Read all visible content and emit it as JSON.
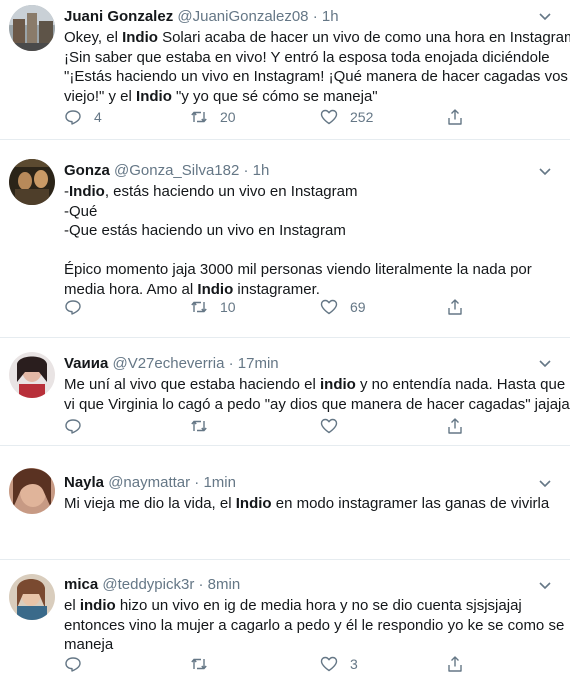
{
  "tweets": [
    {
      "name": "Juani Gonzalez",
      "handle": "@JuaniGonzalez08",
      "sep": "·",
      "time": "1h",
      "lines": [
        [
          {
            "t": "Okey, el "
          },
          {
            "t": "Indio",
            "b": true
          },
          {
            "t": " Solari acaba de hacer un vivo de como una hora en Instagram"
          }
        ],
        [
          {
            "t": "¡Sin saber que estaba en vivo! Y entró la esposa toda enojada diciéndole"
          }
        ],
        [
          {
            "t": "\"¡Estás haciendo un vivo en Instagram! ¡Qué manera de hacer cagadas vos"
          }
        ],
        [
          {
            "t": "viejo!\" y el "
          },
          {
            "t": "Indio",
            "b": true
          },
          {
            "t": " \"y yo que sé cómo se maneja\""
          }
        ]
      ],
      "replies": "4",
      "retweets": "20",
      "likes": "252"
    },
    {
      "name": "Gonza",
      "handle": "@Gonza_Silva182",
      "sep": "·",
      "time": "1h",
      "lines": [
        [
          {
            "t": "-"
          },
          {
            "t": "Indio",
            "b": true
          },
          {
            "t": ", estás haciendo un vivo en Instagram"
          }
        ],
        [
          {
            "t": "-Qué"
          }
        ],
        [
          {
            "t": "-Que estás haciendo un vivo en Instagram"
          }
        ],
        [
          {
            "t": ""
          }
        ],
        [
          {
            "t": "Épico momento jaja 3000 mil personas viendo literalmente la nada por"
          }
        ],
        [
          {
            "t": "media hora. Amo al "
          },
          {
            "t": "Indio",
            "b": true
          },
          {
            "t": " instagramer."
          }
        ]
      ],
      "replies": "",
      "retweets": "10",
      "likes": "69"
    },
    {
      "name": "Vaииa",
      "handle": "@V27echeverria",
      "sep": "·",
      "time": "17min",
      "lines": [
        [
          {
            "t": "Me uní al vivo que estaba haciendo el "
          },
          {
            "t": "indio",
            "b": true
          },
          {
            "t": " y no entendía nada. Hasta que"
          }
        ],
        [
          {
            "t": "vi que Virginia lo cagó  a pedo \"ay dios que manera de hacer cagadas\" jajaja"
          }
        ]
      ],
      "replies": "",
      "retweets": "",
      "likes": ""
    },
    {
      "name": "Nayla",
      "handle": "@naymattar",
      "sep": "·",
      "time": "1min",
      "lines": [
        [
          {
            "t": "Mi vieja me dio la vida, el "
          },
          {
            "t": "Indio",
            "b": true
          },
          {
            "t": " en modo instagramer las ganas de vivirla"
          }
        ]
      ],
      "replies": "",
      "retweets": "",
      "likes": ""
    },
    {
      "name": "mica",
      "handle": "@teddypick3r",
      "sep": "·",
      "time": "8min",
      "lines": [
        [
          {
            "t": "el "
          },
          {
            "t": "indio",
            "b": true
          },
          {
            "t": " hizo un vivo en ig de media hora y no se dio cuenta sjsjsjajaj"
          }
        ],
        [
          {
            "t": "entonces vino la mujer a cagarlo a pedo y él le respondio yo ke se como se"
          }
        ],
        [
          {
            "t": "maneja"
          }
        ]
      ],
      "replies": "",
      "retweets": "",
      "likes": "3"
    }
  ],
  "colors": {
    "text": "#14171a",
    "secondary": "#657786",
    "divider": "#e6ecf0"
  }
}
